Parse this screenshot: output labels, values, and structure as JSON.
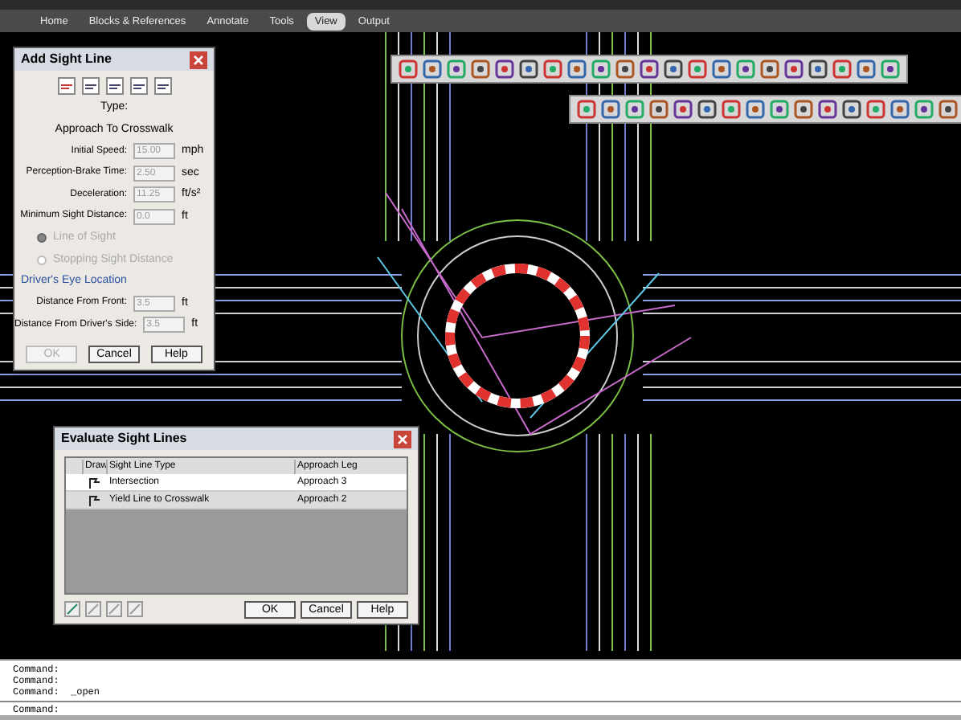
{
  "ribbon_tabs": [
    {
      "label": "Home",
      "selected": false
    },
    {
      "label": "Blocks & References",
      "selected": false
    },
    {
      "label": "Annotate",
      "selected": false
    },
    {
      "label": "Tools",
      "selected": false
    },
    {
      "label": "View",
      "selected": true
    },
    {
      "label": "Output",
      "selected": false
    }
  ],
  "add_sight_line": {
    "title": "Add Sight Line",
    "type_label": "Type:",
    "type_value": "Approach To Crosswalk",
    "fields": [
      {
        "label": "Initial Speed:",
        "value": "15.00",
        "unit": "mph"
      },
      {
        "label": "Perception-Brake Time:",
        "value": "2.50",
        "unit": "sec"
      },
      {
        "label": "Deceleration:",
        "value": "11.25",
        "unit": "ft/s²"
      },
      {
        "label": "Minimum Sight Distance:",
        "value": "0.0",
        "unit": "ft"
      }
    ],
    "options": [
      {
        "label": "Line of Sight",
        "selected": true,
        "disabled": true
      },
      {
        "label": "Stopping Sight Distance",
        "selected": false,
        "disabled": true
      }
    ],
    "section": "Driver's Eye Location",
    "eye_fields": [
      {
        "label": "Distance From Front:",
        "value": "3.5",
        "unit": "ft"
      },
      {
        "label": "Distance From Driver's Side:",
        "value": "3.5",
        "unit": "ft"
      }
    ],
    "buttons": [
      {
        "label": "OK",
        "disabled": true
      },
      {
        "label": "Cancel",
        "disabled": false
      },
      {
        "label": "Help",
        "disabled": false
      }
    ]
  },
  "evaluate": {
    "title": "Evaluate Sight Lines",
    "columns": [
      "Draw",
      "Sight Line Type",
      "Approach Leg"
    ],
    "rows": [
      {
        "type": "Intersection",
        "leg": "Approach 3",
        "selected": false
      },
      {
        "type": "Yield Line to Crosswalk",
        "leg": "Approach 2",
        "selected": true
      }
    ],
    "buttons": [
      "OK",
      "Cancel",
      "Help"
    ]
  },
  "command_history": [
    "Command:",
    "Command:",
    "Command:  _open"
  ],
  "command_prompt": "Command:"
}
